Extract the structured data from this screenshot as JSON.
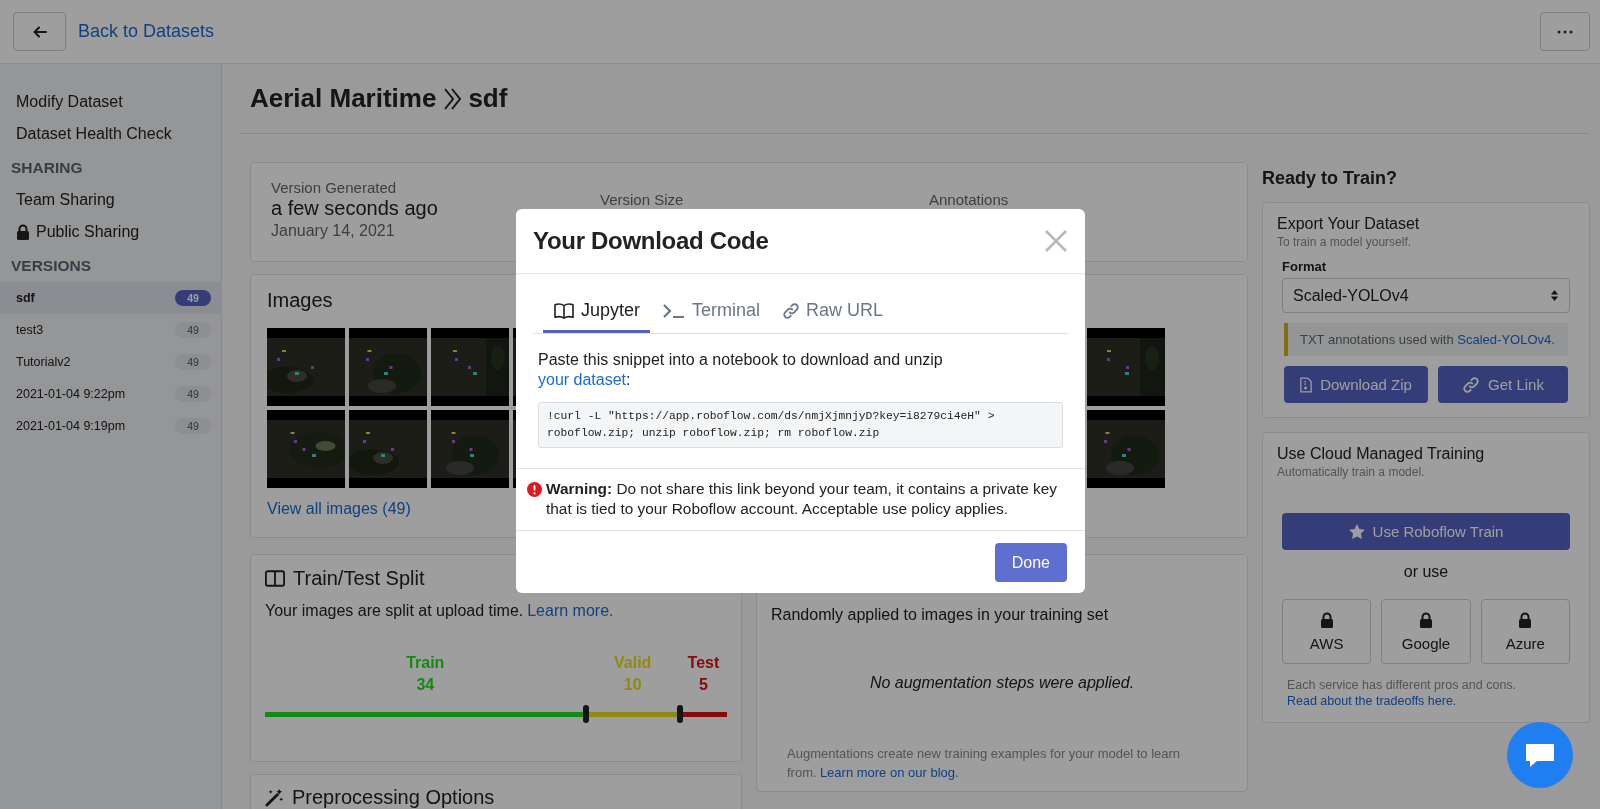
{
  "header": {
    "back_link": "Back to Datasets"
  },
  "sidebar": {
    "items": [
      {
        "label": "Modify Dataset"
      },
      {
        "label": "Dataset Health Check"
      }
    ],
    "sharing": {
      "heading": "SHARING",
      "items": [
        {
          "label": "Team Sharing",
          "locked": false
        },
        {
          "label": "Public Sharing",
          "locked": true
        }
      ]
    },
    "versions": {
      "heading": "VERSIONS",
      "items": [
        {
          "name": "sdf",
          "count": "49",
          "selected": true
        },
        {
          "name": "test3",
          "count": "49",
          "selected": false
        },
        {
          "name": "Tutorialv2",
          "count": "49",
          "selected": false
        },
        {
          "name": "2021-01-04 9:22pm",
          "count": "49",
          "selected": false
        },
        {
          "name": "2021-01-04 9:19pm",
          "count": "49",
          "selected": false
        }
      ]
    }
  },
  "title": {
    "dataset": "Aerial Maritime",
    "version": "sdf"
  },
  "version_card": {
    "stats": [
      {
        "label": "Version Generated",
        "value": "a few seconds ago",
        "sub": "January 14, 2021"
      },
      {
        "label": "Version Size"
      },
      {
        "label": "Annotations"
      }
    ]
  },
  "images": {
    "title": "Images",
    "link": "View all images (49)"
  },
  "split": {
    "title": "Train/Test Split",
    "text": "Your images are split at upload time.",
    "link": "Learn more.",
    "parts": [
      {
        "name": "Train",
        "count": "34",
        "color": "#148a14"
      },
      {
        "name": "Valid",
        "count": "10",
        "color": "#908a10"
      },
      {
        "name": "Test",
        "count": "5",
        "color": "#880c0c"
      }
    ]
  },
  "preprocessing": {
    "title": "Preprocessing Options"
  },
  "augmentation": {
    "text": "Randomly applied to images in your training set",
    "empty": "No augmentation steps were applied.",
    "note": "Augmentations create new training examples for your model to learn from.",
    "link": "Learn more on our blog."
  },
  "train_panel": {
    "heading": "Ready to Train?",
    "export": {
      "title": "Export Your Dataset",
      "subtitle": "To train a model yourself.",
      "format_label": "Format",
      "format_value": "Scaled-YOLOv4",
      "info_text": "TXT annotations used with",
      "info_link": "Scaled-YOLOv4",
      "info_end": ".",
      "buttons": [
        "Download Zip",
        "Get Link"
      ]
    },
    "cloud": {
      "title": "Use Cloud Managed Training",
      "subtitle": "Automatically train a model.",
      "primary": "Use Roboflow Train",
      "or": "or use",
      "providers": [
        {
          "label": "AWS",
          "locked": true
        },
        {
          "label": "Google",
          "locked": true
        },
        {
          "label": "Azure",
          "locked": true
        }
      ],
      "note": "Each service has different pros and cons.",
      "link": "Read about the tradeoffs here."
    }
  },
  "modal": {
    "title": "Your Download Code",
    "tabs": [
      {
        "label": "Jupyter",
        "selected": true
      },
      {
        "label": "Terminal",
        "selected": false
      },
      {
        "label": "Raw URL",
        "selected": false
      }
    ],
    "intro": "Paste this snippet into a notebook to download and unzip",
    "intro_link": "your dataset",
    "intro_end": ":",
    "code": "!curl -L \"https://app.roboflow.com/ds/nmjXjmnjyD?key=i8279ci4eH\" > roboflow.zip; unzip roboflow.zip; rm roboflow.zip",
    "warning": "**Warning:** Do not share this link beyond your team, it contains a private key that is tied to your Roboflow account. Acceptable use policy applies.",
    "done": "Done"
  }
}
